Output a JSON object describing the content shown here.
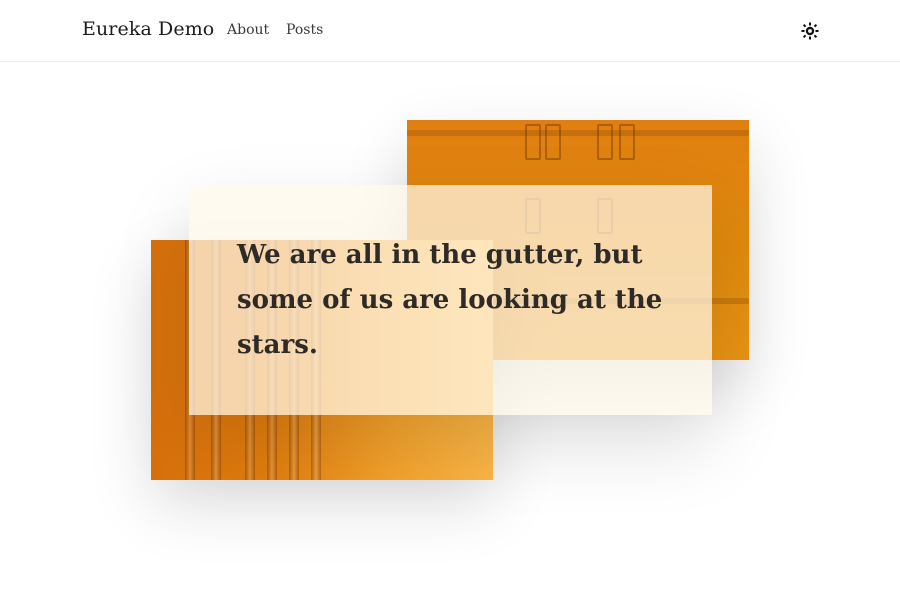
{
  "header": {
    "brand": "Eureka Demo",
    "nav": [
      {
        "label": "About"
      },
      {
        "label": "Posts"
      }
    ],
    "theme_toggle_icon": "sun-icon"
  },
  "hero": {
    "quote": "We are all in the gutter, but some of us are looking at the stars.",
    "accent_color": "#e08a0d",
    "card_color": "#fff8ea"
  }
}
